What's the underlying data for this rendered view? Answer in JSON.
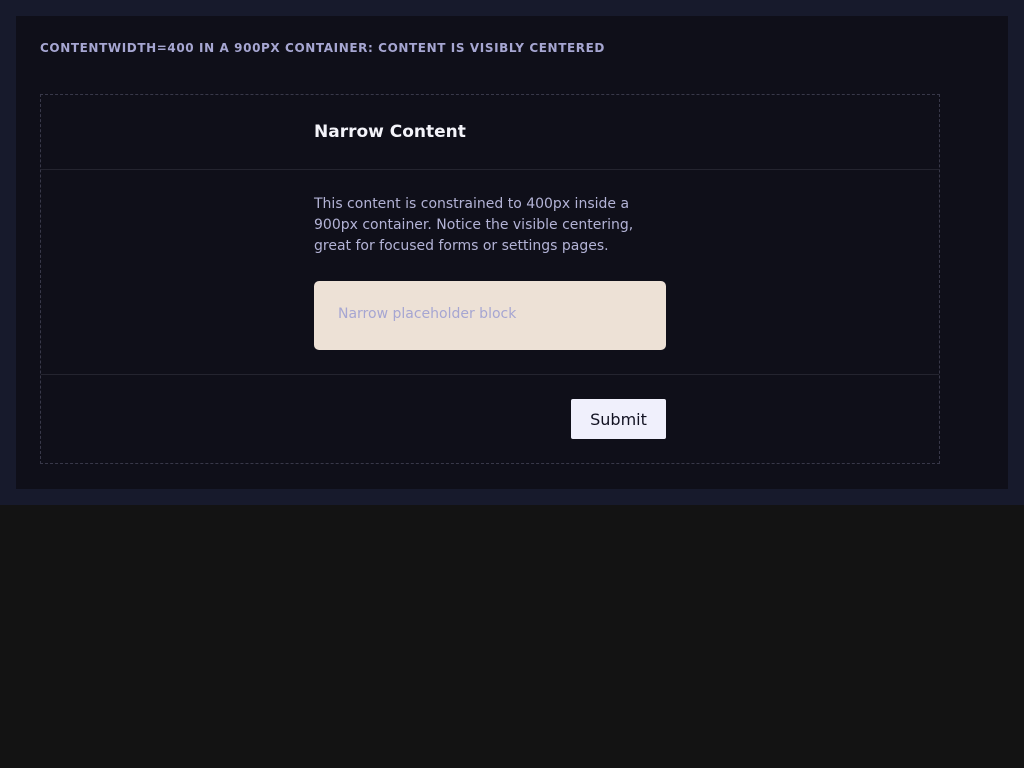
{
  "page": {
    "caption": "CONTENTWIDTH=400 IN A 900PX CONTAINER: CONTENT IS VISIBLY CENTERED"
  },
  "section": {
    "title": "Narrow Content",
    "description": "This content is constrained to 400px inside a 900px container. Notice the visible centering, great for focused forms or settings pages.",
    "placeholder_text": "Narrow placeholder block",
    "submit_label": "Submit"
  },
  "colors": {
    "page_background": "#131313",
    "outer_frame": "#171a2c",
    "panel_background": "#0f0f19",
    "container_border": "#383849",
    "title_text": "#f4f4fa",
    "body_text": "#b3b3d6",
    "placeholder_background": "#ede1d6",
    "button_background": "#f0f0fc",
    "button_text": "#121222"
  }
}
